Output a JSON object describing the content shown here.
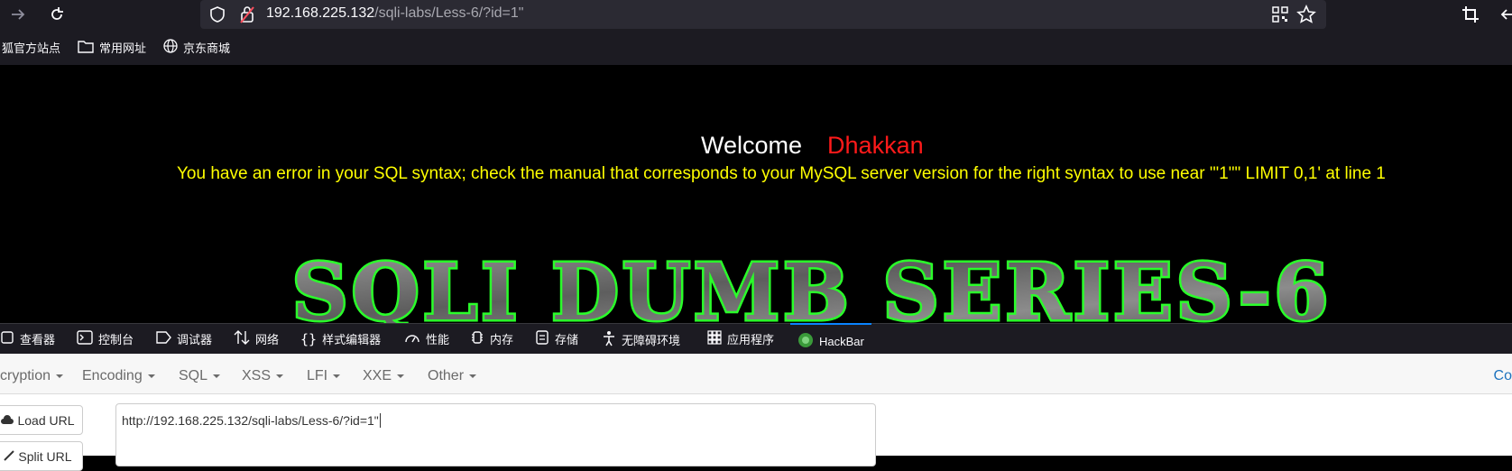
{
  "browser": {
    "url_host": "192.168.225.132",
    "url_path": "/sqli-labs/Less-6/?id=1\"",
    "bookmarks": [
      "狐官方站点",
      "常用网址",
      "京东商城"
    ]
  },
  "page": {
    "welcome": "Welcome",
    "name": "Dhakkan",
    "sql_error": "You have an error in your SQL syntax; check the manual that corresponds to your MySQL server version for the right syntax to use near '\"1\"\" LIMIT 0,1' at line 1",
    "banner_text": "SQLI DUMB SERIES-6"
  },
  "devtools": {
    "tabs": [
      "查看器",
      "控制台",
      "调试器",
      "网络",
      "样式编辑器",
      "性能",
      "内存",
      "存储",
      "无障碍环境",
      "应用程序",
      "HackBar"
    ],
    "active_tab": "HackBar"
  },
  "hackbar": {
    "menu": [
      "cryption",
      "Encoding",
      "SQL",
      "XSS",
      "LFI",
      "XXE",
      "Other"
    ],
    "right_link": "Co",
    "load_url": "Load URL",
    "split_url": "Split URL",
    "url_value": "http://192.168.225.132/sqli-labs/Less-6/?id=1\""
  }
}
